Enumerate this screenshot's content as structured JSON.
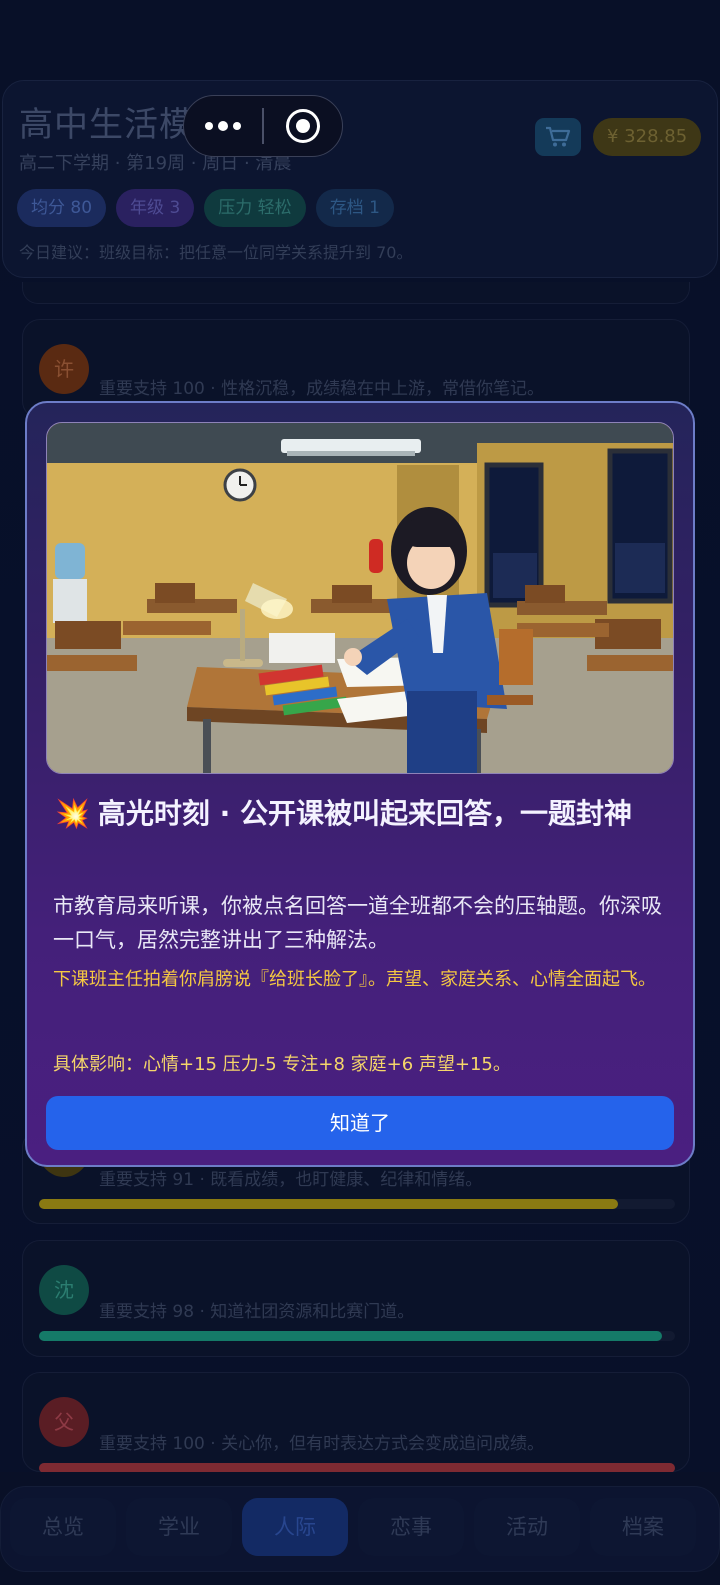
{
  "header": {
    "title": "高中生活模拟器",
    "subtitle": "高二下学期 · 第19周 · 周日 · 清晨",
    "chips": [
      "均分 80",
      "年级 3",
      "压力 轻松",
      "存档 1"
    ],
    "advice": "今日建议：班级目标：把任意一位同学关系提升到 70。",
    "balance": "¥ 328.85",
    "cart_icon": "cart-icon"
  },
  "capsule": {
    "more_icon": "more-dots-icon",
    "close_icon": "close-target-icon"
  },
  "cards": [
    {
      "avatar": "许",
      "text": "重要支持 100 · 性格沉稳，成绩稳在中上游，常借你笔记。",
      "value": 100,
      "color": "#7a3a1a"
    },
    {
      "avatar": "",
      "text": "重要支持 91 · 既看成绩，也盯健康、纪律和情绪。",
      "value": 91,
      "color": "#9c8a14"
    },
    {
      "avatar": "沈",
      "text": "重要支持 98 · 知道社团资源和比赛门道。",
      "value": 98,
      "color": "#15806c"
    },
    {
      "avatar": "父",
      "text": "重要支持 100 · 关心你，但有时表达方式会变成追问成绩。",
      "value": 100,
      "color": "#8e2c35"
    }
  ],
  "nav": {
    "tabs": [
      "总览",
      "学业",
      "人际",
      "恋事",
      "活动",
      "档案"
    ],
    "active_index": 2
  },
  "modal": {
    "icon": "💥",
    "title": "高光时刻 · 公开课被叫起来回答，一题封神",
    "description": "市教育局来听课，你被点名回答一道全班都不会的压轴题。你深吸一口气，居然完整讲出了三种解法。",
    "note": "下课班主任拍着你肩膀说『给班长脸了』。声望、家庭关系、心情全面起飞。",
    "impact": "具体影响：心情+15  压力-5  专注+8  家庭+6  声望+15。",
    "button": "知道了",
    "image_alt": "pixel-art-classroom-study-scene"
  }
}
